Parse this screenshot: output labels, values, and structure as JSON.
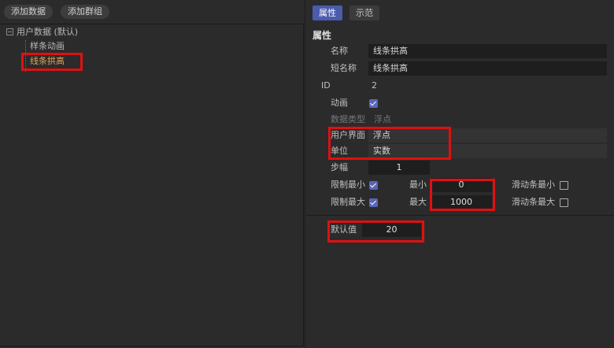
{
  "toolbar": {
    "add_data_label": "添加数据",
    "add_group_label": "添加群组"
  },
  "tree": {
    "root_label": "用户数据 (默认)",
    "items": [
      {
        "label": "样条动画"
      },
      {
        "label": "线条拱高"
      }
    ]
  },
  "tabs": [
    {
      "label": "属性"
    },
    {
      "label": "示范"
    }
  ],
  "properties": {
    "section_title": "属性",
    "name_label": "名称",
    "name_value": "线条拱高",
    "short_name_label": "短名称",
    "short_name_value": "线条拱高",
    "id_label": "ID",
    "id_value": "2",
    "animation_label": "动画",
    "animation_checked": true,
    "data_type_label": "数据类型",
    "data_type_value": "浮点",
    "ui_label": "用户界面",
    "ui_value": "浮点",
    "unit_label": "单位",
    "unit_value": "实数",
    "step_label": "步幅",
    "step_value": "1",
    "limit_min_label": "限制最小",
    "limit_min_checked": true,
    "min_label": "最小",
    "min_value": "0",
    "slider_min_label": "滑动条最小",
    "slider_min_checked": false,
    "limit_max_label": "限制最大",
    "limit_max_checked": true,
    "max_label": "最大",
    "max_value": "1000",
    "slider_max_label": "滑动条最大",
    "slider_max_checked": false,
    "default_label": "默认值",
    "default_value": "20"
  },
  "colors": {
    "accent": "#4b5cad",
    "selected_text": "#e2a55a",
    "highlight_box": "#e01010"
  }
}
